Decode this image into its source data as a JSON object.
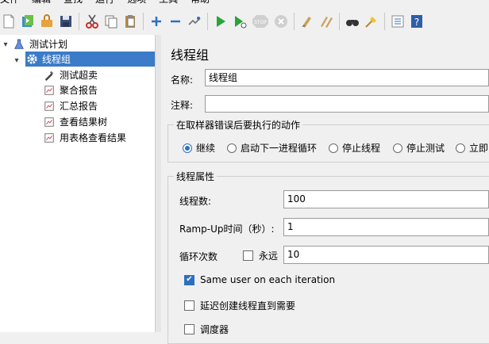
{
  "menu": [
    "文件",
    "编辑",
    "查找",
    "运行",
    "选项",
    "工具",
    "帮助"
  ],
  "toolbar": {
    "icons": [
      "new-icon",
      "templates-icon",
      "open-icon",
      "save-icon",
      "cut-icon",
      "copy-icon",
      "paste-icon",
      "add-icon",
      "remove-icon",
      "toggle-icon",
      "start-icon",
      "start-no-pause-icon",
      "stop-icon",
      "shutdown-icon",
      "clear-icon",
      "clear-all-icon",
      "search-icon",
      "reset-search-icon",
      "function-helper-icon",
      "help-icon"
    ]
  },
  "tree": {
    "test_plan": "测试计划",
    "thread_group": "线程组",
    "children": [
      "测试超卖",
      "聚合报告",
      "汇总报告",
      "查看结果树",
      "用表格查看结果"
    ]
  },
  "panel": {
    "title": "线程组",
    "name_label": "名称:",
    "name_value": "线程组",
    "comment_label": "注释:",
    "comment_value": "",
    "error_group_title": "在取样器错误后要执行的动作",
    "error_actions": [
      "继续",
      "启动下一进程循环",
      "停止线程",
      "停止测试",
      "立即"
    ],
    "error_selected": "继续",
    "props_title": "线程属性",
    "threads_label": "线程数:",
    "threads_value": "100",
    "rampup_label": "Ramp-Up时间（秒）:",
    "rampup_value": "1",
    "loop_label": "循环次数",
    "forever_label": "永远",
    "loop_value": "10",
    "same_user_label": "Same user on each iteration",
    "same_user_checked": true,
    "delay_label": "延迟创建线程直到需要",
    "delay_checked": false,
    "scheduler_label": "调度器",
    "scheduler_checked": false
  },
  "colors": {
    "selection": "#3b7bc7",
    "accent": "#2f6fc0"
  }
}
